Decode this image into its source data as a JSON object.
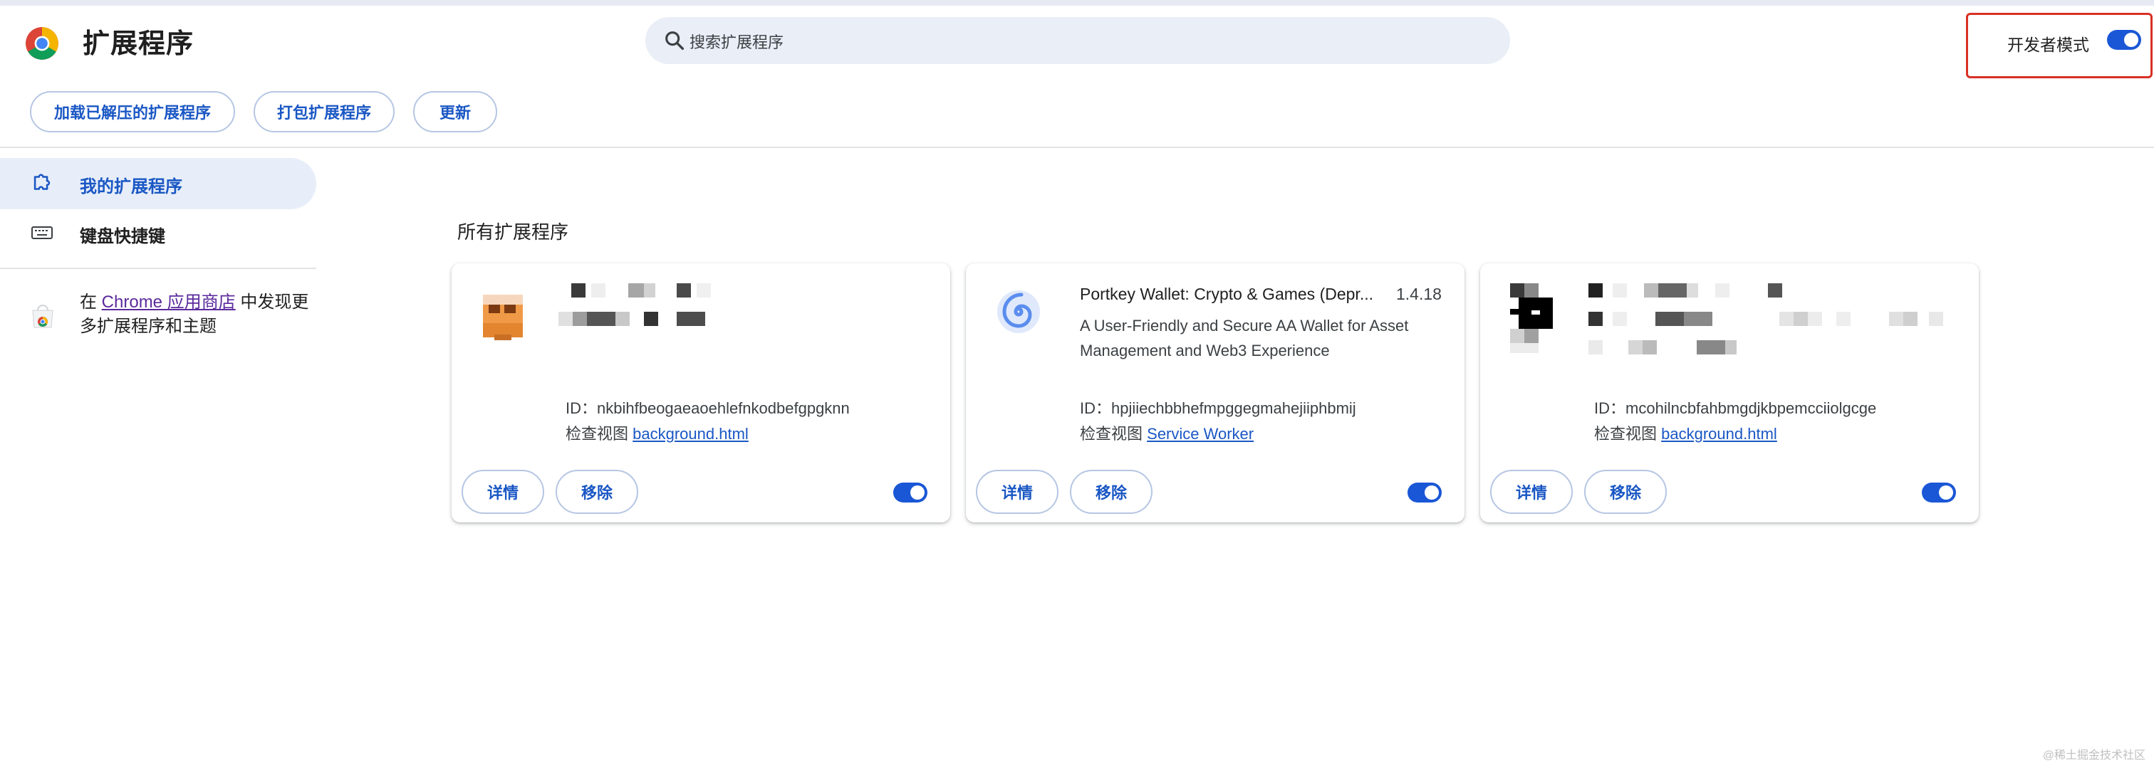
{
  "header": {
    "title": "扩展程序",
    "search_placeholder": "搜索扩展程序",
    "dev_mode_label": "开发者模式",
    "dev_mode_on": true
  },
  "toolbar": {
    "load_unpacked": "加载已解压的扩展程序",
    "pack": "打包扩展程序",
    "update": "更新"
  },
  "sidebar": {
    "items": [
      {
        "label": "我的扩展程序",
        "active": true,
        "icon": "extension-icon"
      },
      {
        "label": "键盘快捷键",
        "active": false,
        "icon": "keyboard-icon"
      }
    ],
    "store_prefix": "在 ",
    "store_link": "Chrome 应用商店",
    "store_suffix": " 中发现更多扩展程序和主题"
  },
  "main": {
    "section_title": "所有扩展程序",
    "cards": [
      {
        "name": "",
        "version": "",
        "description": "",
        "id_label": "ID：",
        "id": "nkbihfbeogaeaoehlefnkodbefgpgknn",
        "inspect_label": "检查视图",
        "inspect_link": "background.html",
        "details": "详情",
        "remove": "移除",
        "enabled": true
      },
      {
        "name": "Portkey Wallet: Crypto & Games (Depr...",
        "version": "1.4.18",
        "description": "A User-Friendly and Secure AA Wallet for Asset Management and Web3 Experience",
        "id_label": "ID：",
        "id": "hpjiiechbbhefmpggegmahejiiphbmij",
        "inspect_label": "检查视图",
        "inspect_link": "Service Worker",
        "details": "详情",
        "remove": "移除",
        "enabled": true
      },
      {
        "name": "",
        "version": "",
        "description": "",
        "id_label": "ID：",
        "id": "mcohilncbfahbmgdjkbpemcciiolgcge",
        "inspect_label": "检查视图",
        "inspect_link": "background.html",
        "details": "详情",
        "remove": "移除",
        "enabled": true
      }
    ]
  },
  "watermark": "@稀土掘金技术社区",
  "colors": {
    "accent": "#1a57d6",
    "highlight_border": "#d93025",
    "link_visited": "#5b2a9d"
  }
}
